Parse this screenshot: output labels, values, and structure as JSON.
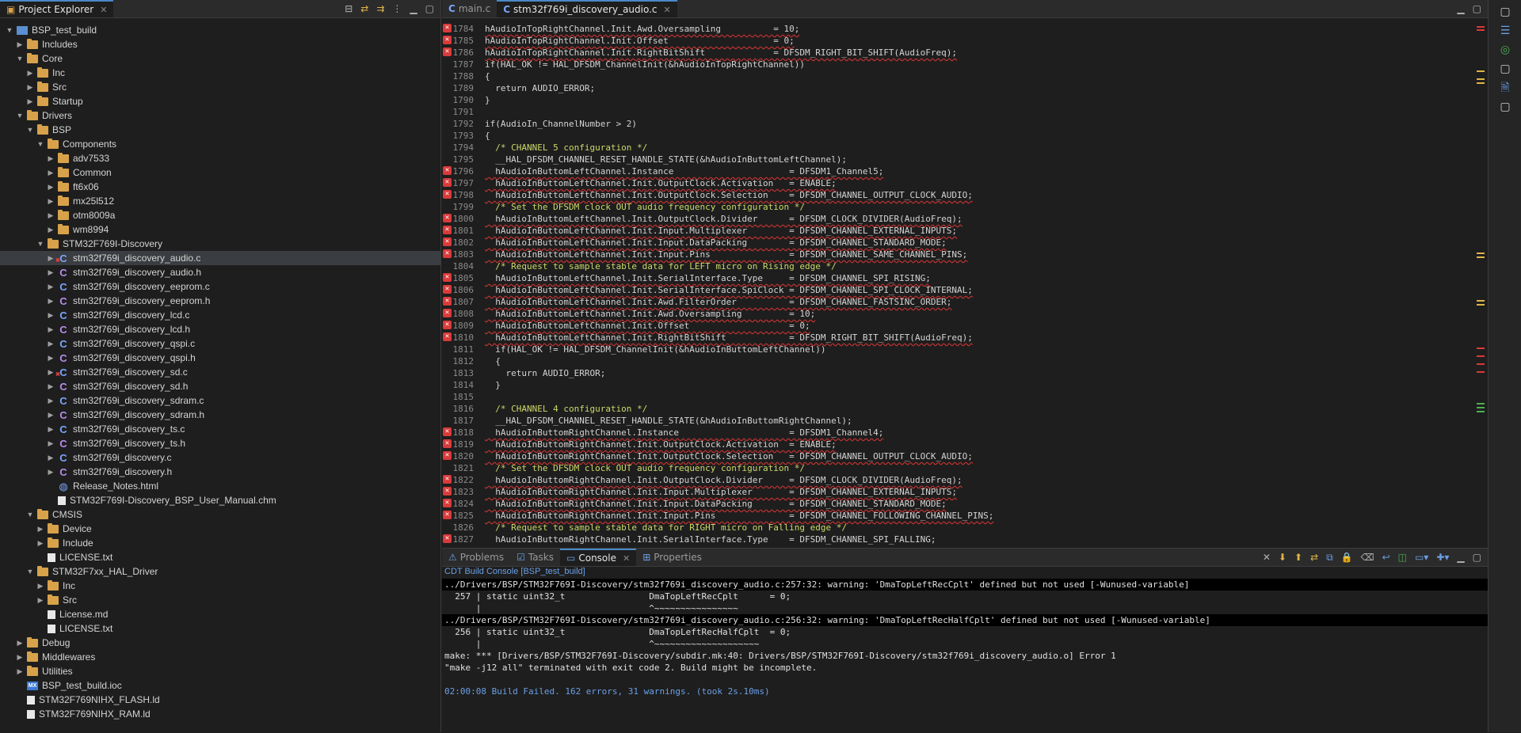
{
  "explorer": {
    "tab_label": "Project Explorer",
    "tree": [
      {
        "label": "BSP_test_build",
        "depth": 0,
        "expanded": true,
        "icon": "project-icon"
      },
      {
        "label": "Includes",
        "depth": 1,
        "expanded": false,
        "icon": "folder-icon"
      },
      {
        "label": "Core",
        "depth": 1,
        "expanded": true,
        "icon": "folder-icon"
      },
      {
        "label": "Inc",
        "depth": 2,
        "expanded": false,
        "icon": "folder-icon"
      },
      {
        "label": "Src",
        "depth": 2,
        "expanded": false,
        "icon": "folder-icon"
      },
      {
        "label": "Startup",
        "depth": 2,
        "expanded": false,
        "icon": "folder-icon"
      },
      {
        "label": "Drivers",
        "depth": 1,
        "expanded": true,
        "icon": "folder-icon"
      },
      {
        "label": "BSP",
        "depth": 2,
        "expanded": true,
        "icon": "folder-icon"
      },
      {
        "label": "Components",
        "depth": 3,
        "expanded": true,
        "icon": "folder-icon"
      },
      {
        "label": "adv7533",
        "depth": 4,
        "expanded": false,
        "icon": "folder-icon"
      },
      {
        "label": "Common",
        "depth": 4,
        "expanded": false,
        "icon": "folder-icon"
      },
      {
        "label": "ft6x06",
        "depth": 4,
        "expanded": false,
        "icon": "folder-icon"
      },
      {
        "label": "mx25l512",
        "depth": 4,
        "expanded": false,
        "icon": "folder-icon"
      },
      {
        "label": "otm8009a",
        "depth": 4,
        "expanded": false,
        "icon": "folder-icon"
      },
      {
        "label": "wm8994",
        "depth": 4,
        "expanded": false,
        "icon": "folder-icon"
      },
      {
        "label": "STM32F769I-Discovery",
        "depth": 3,
        "expanded": true,
        "icon": "folder-icon"
      },
      {
        "label": "stm32f769i_discovery_audio.c",
        "depth": 4,
        "expanded": false,
        "icon": "c-file-error-icon",
        "selected": true
      },
      {
        "label": "stm32f769i_discovery_audio.h",
        "depth": 4,
        "expanded": false,
        "icon": "h-file-error-icon"
      },
      {
        "label": "stm32f769i_discovery_eeprom.c",
        "depth": 4,
        "expanded": false,
        "icon": "c-file-icon"
      },
      {
        "label": "stm32f769i_discovery_eeprom.h",
        "depth": 4,
        "expanded": false,
        "icon": "h-file-icon"
      },
      {
        "label": "stm32f769i_discovery_lcd.c",
        "depth": 4,
        "expanded": false,
        "icon": "c-file-icon"
      },
      {
        "label": "stm32f769i_discovery_lcd.h",
        "depth": 4,
        "expanded": false,
        "icon": "h-file-icon"
      },
      {
        "label": "stm32f769i_discovery_qspi.c",
        "depth": 4,
        "expanded": false,
        "icon": "c-file-icon"
      },
      {
        "label": "stm32f769i_discovery_qspi.h",
        "depth": 4,
        "expanded": false,
        "icon": "h-file-icon"
      },
      {
        "label": "stm32f769i_discovery_sd.c",
        "depth": 4,
        "expanded": false,
        "icon": "c-file-error-icon"
      },
      {
        "label": "stm32f769i_discovery_sd.h",
        "depth": 4,
        "expanded": false,
        "icon": "h-file-error-icon"
      },
      {
        "label": "stm32f769i_discovery_sdram.c",
        "depth": 4,
        "expanded": false,
        "icon": "c-file-icon"
      },
      {
        "label": "stm32f769i_discovery_sdram.h",
        "depth": 4,
        "expanded": false,
        "icon": "h-file-icon"
      },
      {
        "label": "stm32f769i_discovery_ts.c",
        "depth": 4,
        "expanded": false,
        "icon": "c-file-icon"
      },
      {
        "label": "stm32f769i_discovery_ts.h",
        "depth": 4,
        "expanded": false,
        "icon": "h-file-icon"
      },
      {
        "label": "stm32f769i_discovery.c",
        "depth": 4,
        "expanded": false,
        "icon": "c-file-icon"
      },
      {
        "label": "stm32f769i_discovery.h",
        "depth": 4,
        "expanded": false,
        "icon": "h-file-icon"
      },
      {
        "label": "Release_Notes.html",
        "depth": 4,
        "leaf": true,
        "icon": "html-file-icon"
      },
      {
        "label": "STM32F769I-Discovery_BSP_User_Manual.chm",
        "depth": 4,
        "leaf": true,
        "icon": "chm-file-icon"
      },
      {
        "label": "CMSIS",
        "depth": 2,
        "expanded": true,
        "icon": "folder-icon"
      },
      {
        "label": "Device",
        "depth": 3,
        "expanded": false,
        "icon": "folder-icon"
      },
      {
        "label": "Include",
        "depth": 3,
        "expanded": false,
        "icon": "folder-icon"
      },
      {
        "label": "LICENSE.txt",
        "depth": 3,
        "leaf": true,
        "icon": "text-file-icon"
      },
      {
        "label": "STM32F7xx_HAL_Driver",
        "depth": 2,
        "expanded": true,
        "icon": "folder-icon"
      },
      {
        "label": "Inc",
        "depth": 3,
        "expanded": false,
        "icon": "folder-icon"
      },
      {
        "label": "Src",
        "depth": 3,
        "expanded": false,
        "icon": "folder-icon"
      },
      {
        "label": "License.md",
        "depth": 3,
        "leaf": true,
        "icon": "text-file-icon"
      },
      {
        "label": "LICENSE.txt",
        "depth": 3,
        "leaf": true,
        "icon": "text-file-icon"
      },
      {
        "label": "Debug",
        "depth": 1,
        "expanded": false,
        "icon": "folder-icon"
      },
      {
        "label": "Middlewares",
        "depth": 1,
        "expanded": false,
        "icon": "folder-icon"
      },
      {
        "label": "Utilities",
        "depth": 1,
        "expanded": false,
        "icon": "folder-icon"
      },
      {
        "label": "BSP_test_build.ioc",
        "depth": 1,
        "leaf": true,
        "icon": "ioc-file-icon"
      },
      {
        "label": "STM32F769NIHX_FLASH.ld",
        "depth": 1,
        "leaf": true,
        "icon": "ld-file-icon"
      },
      {
        "label": "STM32F769NIHX_RAM.ld",
        "depth": 1,
        "leaf": true,
        "icon": "ld-file-icon"
      }
    ]
  },
  "editor": {
    "tabs": [
      {
        "label": "main.c",
        "active": false
      },
      {
        "label": "stm32f769i_discovery_audio.c",
        "active": true
      }
    ],
    "lines": [
      {
        "n": "1784",
        "err": true,
        "text": "hAudioInTopRightChannel.Init.Awd.Oversampling          = 10;"
      },
      {
        "n": "1785",
        "err": true,
        "text": "hAudioInTopRightChannel.Init.Offset                    = 0;"
      },
      {
        "n": "1786",
        "err": true,
        "text": "hAudioInTopRightChannel.Init.RightBitShift             = DFSDM_RIGHT_BIT_SHIFT(AudioFreq);"
      },
      {
        "n": "1787",
        "err": false,
        "text": "if(HAL_OK != HAL_DFSDM_ChannelInit(&hAudioInTopRightChannel))"
      },
      {
        "n": "1788",
        "err": false,
        "text": "{"
      },
      {
        "n": "1789",
        "err": false,
        "text": "  return AUDIO_ERROR;"
      },
      {
        "n": "1790",
        "err": false,
        "text": "}"
      },
      {
        "n": "1791",
        "err": false,
        "text": ""
      },
      {
        "n": "1792",
        "err": false,
        "text": "if(AudioIn_ChannelNumber > 2)"
      },
      {
        "n": "1793",
        "err": false,
        "text": "{"
      },
      {
        "n": "1794",
        "err": false,
        "comment": true,
        "text": "  /* CHANNEL 5 configuration */"
      },
      {
        "n": "1795",
        "err": false,
        "text": "  __HAL_DFSDM_CHANNEL_RESET_HANDLE_STATE(&hAudioInButtomLeftChannel);"
      },
      {
        "n": "1796",
        "err": true,
        "text": "  hAudioInButtomLeftChannel.Instance                      = DFSDM1_Channel5;"
      },
      {
        "n": "1797",
        "err": true,
        "text": "  hAudioInButtomLeftChannel.Init.OutputClock.Activation   = ENABLE;"
      },
      {
        "n": "1798",
        "err": true,
        "text": "  hAudioInButtomLeftChannel.Init.OutputClock.Selection    = DFSDM_CHANNEL_OUTPUT_CLOCK_AUDIO;"
      },
      {
        "n": "1799",
        "err": false,
        "comment": true,
        "text": "  /* Set the DFSDM clock OUT audio frequency configuration */"
      },
      {
        "n": "1800",
        "err": true,
        "text": "  hAudioInButtomLeftChannel.Init.OutputClock.Divider      = DFSDM_CLOCK_DIVIDER(AudioFreq);"
      },
      {
        "n": "1801",
        "err": true,
        "text": "  hAudioInButtomLeftChannel.Init.Input.Multiplexer        = DFSDM_CHANNEL_EXTERNAL_INPUTS;"
      },
      {
        "n": "1802",
        "err": true,
        "text": "  hAudioInButtomLeftChannel.Init.Input.DataPacking        = DFSDM_CHANNEL_STANDARD_MODE;"
      },
      {
        "n": "1803",
        "err": true,
        "text": "  hAudioInButtomLeftChannel.Init.Input.Pins               = DFSDM_CHANNEL_SAME_CHANNEL_PINS;"
      },
      {
        "n": "1804",
        "err": false,
        "comment": true,
        "text": "  /* Request to sample stable data for LEFT micro on Rising edge */"
      },
      {
        "n": "1805",
        "err": true,
        "text": "  hAudioInButtomLeftChannel.Init.SerialInterface.Type     = DFSDM_CHANNEL_SPI_RISING;"
      },
      {
        "n": "1806",
        "err": true,
        "text": "  hAudioInButtomLeftChannel.Init.SerialInterface.SpiClock = DFSDM_CHANNEL_SPI_CLOCK_INTERNAL;"
      },
      {
        "n": "1807",
        "err": true,
        "text": "  hAudioInButtomLeftChannel.Init.Awd.FilterOrder          = DFSDM_CHANNEL_FASTSINC_ORDER;"
      },
      {
        "n": "1808",
        "err": true,
        "text": "  hAudioInButtomLeftChannel.Init.Awd.Oversampling         = 10;"
      },
      {
        "n": "1809",
        "err": true,
        "text": "  hAudioInButtomLeftChannel.Init.Offset                   = 0;"
      },
      {
        "n": "1810",
        "err": true,
        "text": "  hAudioInButtomLeftChannel.Init.RightBitShift            = DFSDM_RIGHT_BIT_SHIFT(AudioFreq);"
      },
      {
        "n": "1811",
        "err": false,
        "text": "  if(HAL_OK != HAL_DFSDM_ChannelInit(&hAudioInButtomLeftChannel))"
      },
      {
        "n": "1812",
        "err": false,
        "text": "  {"
      },
      {
        "n": "1813",
        "err": false,
        "text": "    return AUDIO_ERROR;"
      },
      {
        "n": "1814",
        "err": false,
        "text": "  }"
      },
      {
        "n": "1815",
        "err": false,
        "text": ""
      },
      {
        "n": "1816",
        "err": false,
        "comment": true,
        "text": "  /* CHANNEL 4 configuration */"
      },
      {
        "n": "1817",
        "err": false,
        "text": "  __HAL_DFSDM_CHANNEL_RESET_HANDLE_STATE(&hAudioInButtomRightChannel);"
      },
      {
        "n": "1818",
        "err": true,
        "text": "  hAudioInButtomRightChannel.Instance                     = DFSDM1_Channel4;"
      },
      {
        "n": "1819",
        "err": true,
        "text": "  hAudioInButtomRightChannel.Init.OutputClock.Activation  = ENABLE;"
      },
      {
        "n": "1820",
        "err": true,
        "text": "  hAudioInButtomRightChannel.Init.OutputClock.Selection   = DFSDM_CHANNEL_OUTPUT_CLOCK_AUDIO;"
      },
      {
        "n": "1821",
        "err": false,
        "comment": true,
        "text": "  /* Set the DFSDM clock OUT audio frequency configuration */"
      },
      {
        "n": "1822",
        "err": true,
        "text": "  hAudioInButtomRightChannel.Init.OutputClock.Divider     = DFSDM_CLOCK_DIVIDER(AudioFreq);"
      },
      {
        "n": "1823",
        "err": true,
        "text": "  hAudioInButtomRightChannel.Init.Input.Multiplexer       = DFSDM_CHANNEL_EXTERNAL_INPUTS;"
      },
      {
        "n": "1824",
        "err": true,
        "text": "  hAudioInButtomRightChannel.Init.Input.DataPacking       = DFSDM_CHANNEL_STANDARD_MODE;"
      },
      {
        "n": "1825",
        "err": true,
        "text": "  hAudioInButtomRightChannel.Init.Input.Pins              = DFSDM_CHANNEL_FOLLOWING_CHANNEL_PINS;"
      },
      {
        "n": "1826",
        "err": false,
        "comment": true,
        "text": "  /* Request to sample stable data for RIGHT micro on Falling edge */"
      },
      {
        "n": "1827",
        "err": true,
        "text": "  hAudioInButtomRightChannel.Init.SerialInterface.Type    = DFSDM_CHANNEL_SPI_FALLING;"
      }
    ]
  },
  "console": {
    "tabs": [
      {
        "label": "Problems",
        "active": false
      },
      {
        "label": "Tasks",
        "active": false
      },
      {
        "label": "Console",
        "active": true
      },
      {
        "label": "Properties",
        "active": false
      }
    ],
    "title": "CDT Build Console [BSP_test_build]",
    "lines": [
      {
        "text": "../Drivers/BSP/STM32F769I-Discovery/stm32f769i_discovery_audio.c:257:32: warning: 'DmaTopLeftRecCplt' defined but not used [-Wunused-variable]",
        "style": "hl"
      },
      {
        "text": "  257 | static uint32_t                DmaTopLeftRecCplt      = 0;",
        "style": ""
      },
      {
        "text": "      |                                ^~~~~~~~~~~~~~~~~",
        "style": ""
      },
      {
        "text": "../Drivers/BSP/STM32F769I-Discovery/stm32f769i_discovery_audio.c:256:32: warning: 'DmaTopLeftRecHalfCplt' defined but not used [-Wunused-variable]",
        "style": "hl"
      },
      {
        "text": "  256 | static uint32_t                DmaTopLeftRecHalfCplt  = 0;",
        "style": ""
      },
      {
        "text": "      |                                ^~~~~~~~~~~~~~~~~~~~~",
        "style": ""
      },
      {
        "text": "make: *** [Drivers/BSP/STM32F769I-Discovery/subdir.mk:40: Drivers/BSP/STM32F769I-Discovery/stm32f769i_discovery_audio.o] Error 1",
        "style": ""
      },
      {
        "text": "\"make -j12 all\" terminated with exit code 2. Build might be incomplete.",
        "style": ""
      },
      {
        "text": "",
        "style": "blank"
      },
      {
        "text": "02:00:08 Build Failed. 162 errors, 31 warnings. (took 2s.10ms)",
        "style": "blue"
      }
    ]
  },
  "colors": {
    "error_red": "#d93a3a",
    "comment_yellow": "#cdd96a",
    "accent_blue": "#6aa0e6",
    "folder_orange": "#d8a24a"
  }
}
